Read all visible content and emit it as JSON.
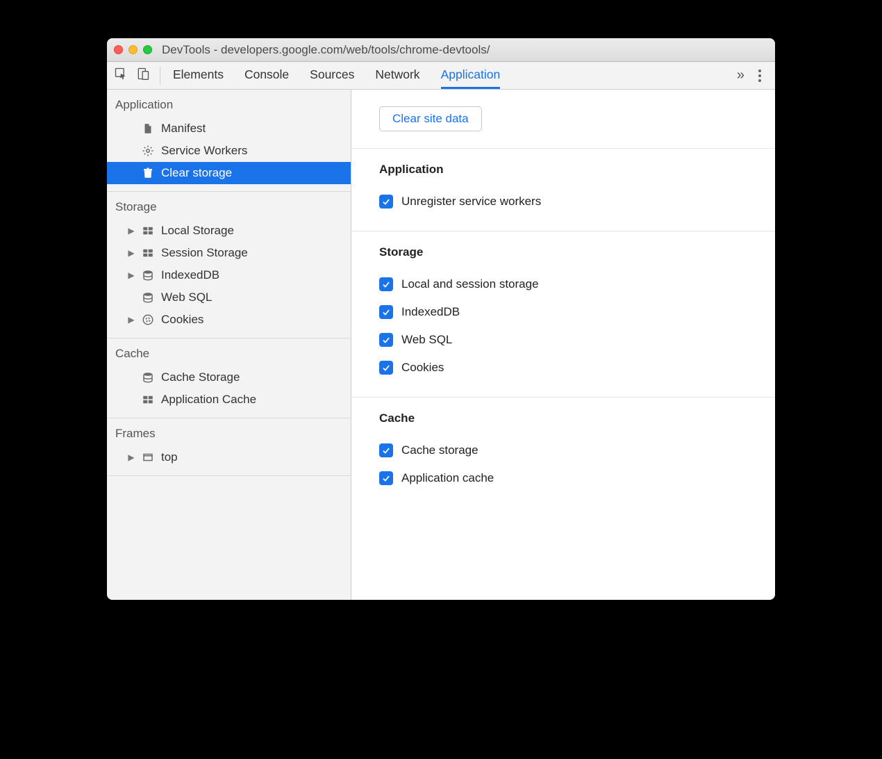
{
  "window": {
    "title": "DevTools - developers.google.com/web/tools/chrome-devtools/"
  },
  "tabs": {
    "items": [
      "Elements",
      "Console",
      "Sources",
      "Network",
      "Application"
    ],
    "active": "Application"
  },
  "sidebar": {
    "groups": [
      {
        "title": "Application",
        "items": [
          {
            "label": "Manifest",
            "icon": "file",
            "expandable": false,
            "selected": false
          },
          {
            "label": "Service Workers",
            "icon": "gear",
            "expandable": false,
            "selected": false
          },
          {
            "label": "Clear storage",
            "icon": "trash",
            "expandable": false,
            "selected": true
          }
        ]
      },
      {
        "title": "Storage",
        "items": [
          {
            "label": "Local Storage",
            "icon": "table",
            "expandable": true,
            "selected": false
          },
          {
            "label": "Session Storage",
            "icon": "table",
            "expandable": true,
            "selected": false
          },
          {
            "label": "IndexedDB",
            "icon": "database",
            "expandable": true,
            "selected": false
          },
          {
            "label": "Web SQL",
            "icon": "database",
            "expandable": false,
            "selected": false
          },
          {
            "label": "Cookies",
            "icon": "cookie",
            "expandable": true,
            "selected": false
          }
        ]
      },
      {
        "title": "Cache",
        "items": [
          {
            "label": "Cache Storage",
            "icon": "database",
            "expandable": false,
            "selected": false
          },
          {
            "label": "Application Cache",
            "icon": "table",
            "expandable": false,
            "selected": false
          }
        ]
      },
      {
        "title": "Frames",
        "items": [
          {
            "label": "top",
            "icon": "frame",
            "expandable": true,
            "selected": false
          }
        ]
      }
    ]
  },
  "content": {
    "clear_button": "Clear site data",
    "sections": [
      {
        "title": "Application",
        "checks": [
          {
            "label": "Unregister service workers",
            "checked": true
          }
        ]
      },
      {
        "title": "Storage",
        "checks": [
          {
            "label": "Local and session storage",
            "checked": true
          },
          {
            "label": "IndexedDB",
            "checked": true
          },
          {
            "label": "Web SQL",
            "checked": true
          },
          {
            "label": "Cookies",
            "checked": true
          }
        ]
      },
      {
        "title": "Cache",
        "checks": [
          {
            "label": "Cache storage",
            "checked": true
          },
          {
            "label": "Application cache",
            "checked": true
          }
        ]
      }
    ]
  },
  "colors": {
    "accent": "#1a73e8"
  }
}
